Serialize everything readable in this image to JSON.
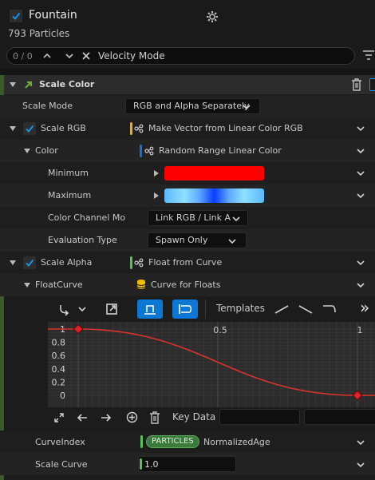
{
  "header": {
    "title": "Fountain",
    "subtitle": "793 Particles"
  },
  "search": {
    "counter": "0 / 0",
    "value": "Velocity Mode"
  },
  "module": {
    "title": "Scale Color",
    "scale_mode_label": "Scale Mode",
    "scale_mode_value": "RGB and Alpha Separately",
    "scale_rgb_label": "Scale RGB",
    "scale_rgb_value": "Make Vector from Linear Color RGB",
    "color_label": "Color",
    "color_value": "Random Range Linear Color",
    "minimum_label": "Minimum",
    "maximum_label": "Maximum",
    "color_channel_label": "Color Channel Mo",
    "color_channel_value": "Link RGB / Link A",
    "evaluation_type_label": "Evaluation Type",
    "evaluation_type_value": "Spawn Only",
    "scale_alpha_label": "Scale Alpha",
    "scale_alpha_value": "Float from Curve",
    "float_curve_label": "FloatCurve",
    "float_curve_value": "Curve for Floats"
  },
  "curve_toolbar": {
    "templates_label": "Templates",
    "more_label": "»"
  },
  "curve": {
    "x_ticks": [
      "0.5",
      "1"
    ],
    "y_ticks": [
      "1",
      "0.8",
      "0.6",
      "0.4",
      "0.2",
      "0"
    ],
    "points": [
      {
        "x": 0.0,
        "y": 1.0
      },
      {
        "x": 1.0,
        "y": 0.0
      }
    ]
  },
  "curve_bottom": {
    "key_data_label": "Key Data"
  },
  "curve_index": {
    "label": "CurveIndex",
    "badge": "PARTICLES",
    "value": "NormalizedAge"
  },
  "scale_curve": {
    "label": "Scale Curve",
    "value": "1.0"
  },
  "colors": {
    "accent_blue": "#0c78d4",
    "checkbox_blue": "#1a8fe8",
    "min_color": "#ff0000",
    "max_color_center": "#0a3cff",
    "max_color_edge": "#7bd4ff",
    "curve_red": "#d9342b",
    "particles_green": "#3a8a3a",
    "dynamic_input_yellow": "#f0b000",
    "dynamic_input_blue": "#1a6fd0",
    "dynamic_input_green": "#5ac05a"
  }
}
